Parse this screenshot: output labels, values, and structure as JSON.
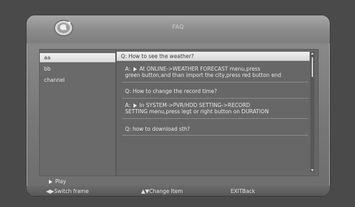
{
  "header": {
    "title": "FAQ",
    "logo_icon": "globe-icon"
  },
  "left_panel": {
    "items": [
      {
        "label": "aa",
        "selected": true
      },
      {
        "label": "bb",
        "selected": false
      },
      {
        "label": "channel",
        "selected": false
      }
    ]
  },
  "right_panel": {
    "q1": {
      "question": "Q: How to see the weather?",
      "answer_prefix": "A:",
      "answer_line1": "At ONLINE->WEATHER FORECAST menu,press",
      "answer_line2": "green button,and than import the city,press red button end"
    },
    "q2": {
      "question": "Q: How to change the record time?",
      "answer_prefix": "A:",
      "answer_line1": "In SYSTEM->PVR/HDD SETTING->RECORD",
      "answer_line2": "SETTING menu,press legt or right button on DURATION"
    },
    "q3": {
      "question": "Q: how to download sth?"
    }
  },
  "play": {
    "label": "Play"
  },
  "footer": {
    "switch_frame": "Switch frame",
    "change_item": "Change Item",
    "exit_back": "EXITBack"
  }
}
